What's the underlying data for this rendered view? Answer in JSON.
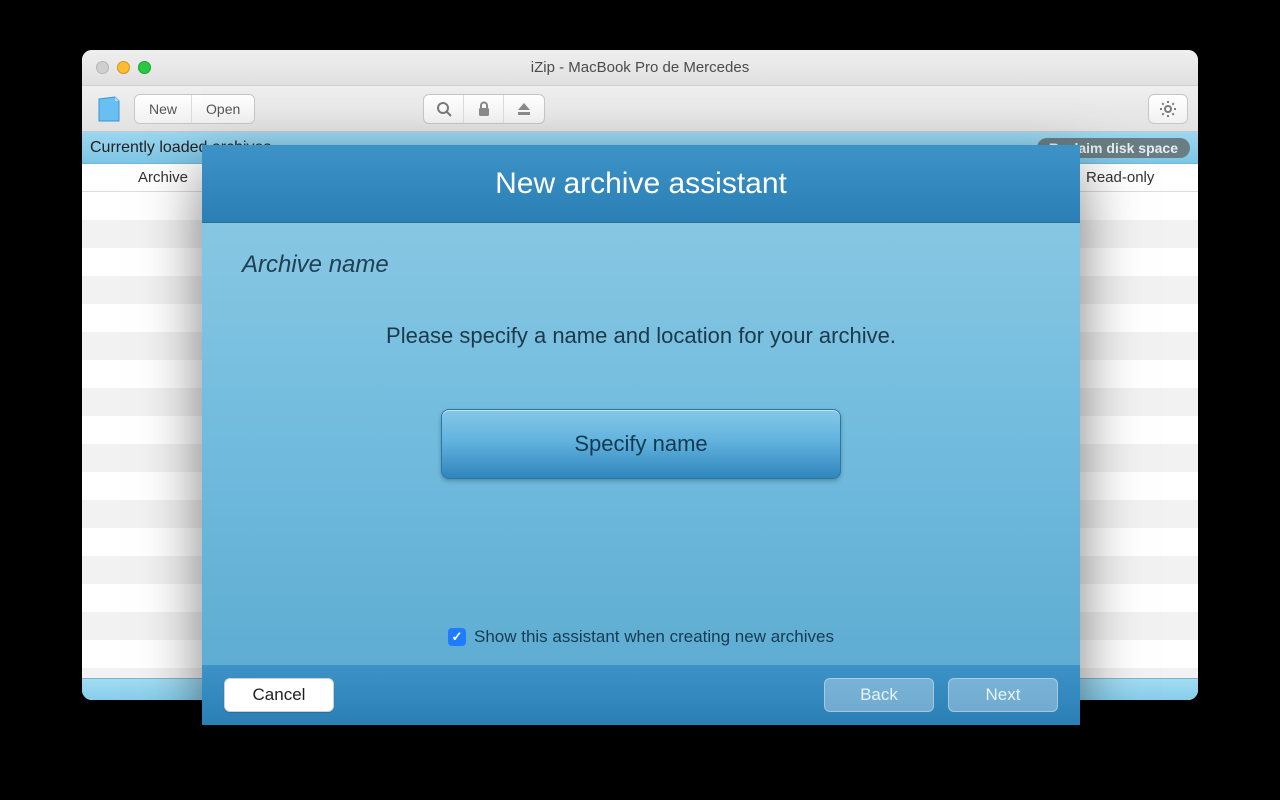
{
  "window": {
    "title": "iZip - MacBook Pro de Mercedes"
  },
  "toolbar": {
    "new_label": "New",
    "open_label": "Open"
  },
  "statusbar": {
    "currently_loaded": "Currently loaded archives",
    "reclaim_label": "Reclaim disk space"
  },
  "table": {
    "col_archive": "Archive",
    "col_readonly": "Read-only"
  },
  "modal": {
    "title": "New archive assistant",
    "subtitle": "Archive name",
    "prompt": "Please specify a name and location for your archive.",
    "specify_label": "Specify name",
    "show_assistant_label": "Show this assistant when creating new archives",
    "cancel_label": "Cancel",
    "back_label": "Back",
    "next_label": "Next",
    "show_assistant_checked": true
  }
}
